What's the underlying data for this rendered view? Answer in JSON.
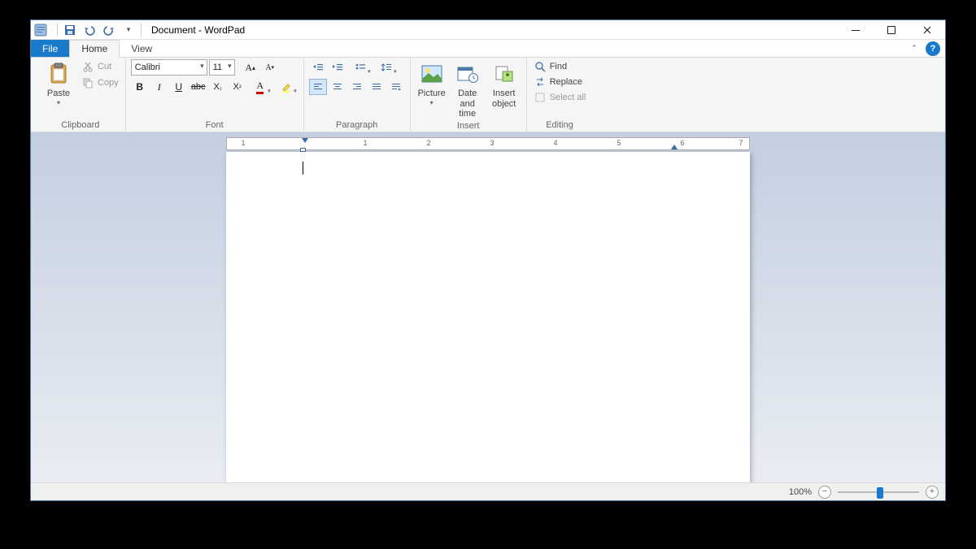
{
  "title": "Document - WordPad",
  "tabs": {
    "file": "File",
    "home": "Home",
    "view": "View"
  },
  "groups": {
    "clipboard": {
      "label": "Clipboard",
      "paste": "Paste",
      "cut": "Cut",
      "copy": "Copy"
    },
    "font": {
      "label": "Font",
      "family": "Calibri",
      "size": "11"
    },
    "paragraph": {
      "label": "Paragraph"
    },
    "insert": {
      "label": "Insert",
      "picture": "Picture",
      "datetime": "Date and time",
      "object": "Insert object"
    },
    "editing": {
      "label": "Editing",
      "find": "Find",
      "replace": "Replace",
      "selectall": "Select all"
    }
  },
  "ruler": {
    "numbers": [
      "1",
      "1",
      "2",
      "3",
      "4",
      "5",
      "6",
      "7"
    ]
  },
  "status": {
    "zoom": "100%"
  },
  "help": "?"
}
